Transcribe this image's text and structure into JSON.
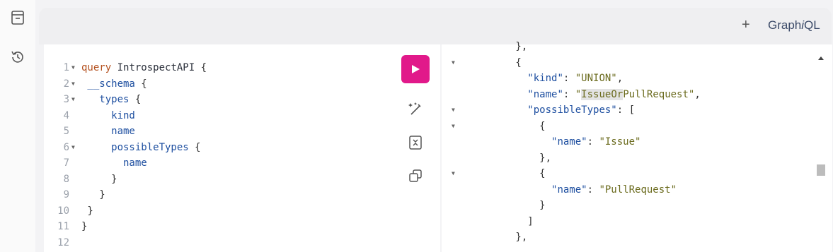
{
  "header": {
    "add_tab_label": "+",
    "brand_prefix": "Graph",
    "brand_italic": "i",
    "brand_suffix": "QL"
  },
  "sidebar": {
    "icons": [
      "docs-icon",
      "history-icon"
    ]
  },
  "editor": {
    "lines": [
      {
        "n": "1",
        "fold": true,
        "tokens": [
          {
            "t": "query",
            "c": "kw"
          },
          {
            "t": " IntrospectAPI ",
            "c": "def"
          },
          {
            "t": "{",
            "c": "punc"
          }
        ]
      },
      {
        "n": "2",
        "fold": true,
        "tokens": [
          {
            "t": " __schema ",
            "c": "fld"
          },
          {
            "t": "{",
            "c": "punc"
          }
        ]
      },
      {
        "n": "3",
        "fold": true,
        "tokens": [
          {
            "t": "   types ",
            "c": "fld"
          },
          {
            "t": "{",
            "c": "punc"
          }
        ]
      },
      {
        "n": "4",
        "fold": false,
        "tokens": [
          {
            "t": "     kind",
            "c": "fld"
          }
        ]
      },
      {
        "n": "5",
        "fold": false,
        "tokens": [
          {
            "t": "     name",
            "c": "fld"
          }
        ]
      },
      {
        "n": "6",
        "fold": true,
        "tokens": [
          {
            "t": "     possibleTypes ",
            "c": "fld"
          },
          {
            "t": "{",
            "c": "punc"
          }
        ]
      },
      {
        "n": "7",
        "fold": false,
        "tokens": [
          {
            "t": "       name",
            "c": "fld"
          }
        ]
      },
      {
        "n": "8",
        "fold": false,
        "tokens": [
          {
            "t": "     }",
            "c": "punc"
          }
        ]
      },
      {
        "n": "9",
        "fold": false,
        "tokens": [
          {
            "t": "   }",
            "c": "punc"
          }
        ]
      },
      {
        "n": "10",
        "fold": false,
        "tokens": [
          {
            "t": " }",
            "c": "punc"
          }
        ]
      },
      {
        "n": "11",
        "fold": false,
        "tokens": [
          {
            "t": "}",
            "c": "punc"
          }
        ]
      },
      {
        "n": "12",
        "fold": false,
        "tokens": []
      }
    ]
  },
  "toolbar": {
    "run": "play-icon",
    "prettify": "prettify-icon",
    "merge": "merge-fragments-icon",
    "copy": "copy-icon"
  },
  "results": {
    "lines": [
      {
        "fold": false,
        "tokens": [
          {
            "t": "        },",
            "c": "punc"
          }
        ]
      },
      {
        "fold": true,
        "tokens": [
          {
            "t": "        {",
            "c": "punc"
          }
        ]
      },
      {
        "fold": false,
        "tokens": [
          {
            "t": "          ",
            "c": "punc"
          },
          {
            "t": "\"kind\"",
            "c": "fld"
          },
          {
            "t": ": ",
            "c": "punc"
          },
          {
            "t": "\"UNION\"",
            "c": "str"
          },
          {
            "t": ",",
            "c": "punc"
          }
        ]
      },
      {
        "fold": false,
        "tokens": [
          {
            "t": "          ",
            "c": "punc"
          },
          {
            "t": "\"name\"",
            "c": "fld"
          },
          {
            "t": ": ",
            "c": "punc"
          },
          {
            "t": "\"",
            "c": "str"
          },
          {
            "t": "IssueOr",
            "c": "str hl"
          },
          {
            "t": "PullRequest\"",
            "c": "str"
          },
          {
            "t": ",",
            "c": "punc"
          }
        ]
      },
      {
        "fold": true,
        "tokens": [
          {
            "t": "          ",
            "c": "punc"
          },
          {
            "t": "\"possibleTypes\"",
            "c": "fld"
          },
          {
            "t": ": [",
            "c": "punc"
          }
        ]
      },
      {
        "fold": true,
        "tokens": [
          {
            "t": "            {",
            "c": "punc"
          }
        ]
      },
      {
        "fold": false,
        "tokens": [
          {
            "t": "              ",
            "c": "punc"
          },
          {
            "t": "\"name\"",
            "c": "fld"
          },
          {
            "t": ": ",
            "c": "punc"
          },
          {
            "t": "\"Issue\"",
            "c": "str"
          }
        ]
      },
      {
        "fold": false,
        "tokens": [
          {
            "t": "            },",
            "c": "punc"
          }
        ]
      },
      {
        "fold": true,
        "tokens": [
          {
            "t": "            {",
            "c": "punc"
          }
        ]
      },
      {
        "fold": false,
        "tokens": [
          {
            "t": "              ",
            "c": "punc"
          },
          {
            "t": "\"name\"",
            "c": "fld"
          },
          {
            "t": ": ",
            "c": "punc"
          },
          {
            "t": "\"PullRequest\"",
            "c": "str"
          }
        ]
      },
      {
        "fold": false,
        "tokens": [
          {
            "t": "            }",
            "c": "punc"
          }
        ]
      },
      {
        "fold": false,
        "tokens": [
          {
            "t": "          ]",
            "c": "punc"
          }
        ]
      },
      {
        "fold": false,
        "tokens": [
          {
            "t": "        },",
            "c": "punc"
          }
        ]
      }
    ]
  },
  "colors": {
    "run": "#e1198a",
    "brand": "#3b4a68"
  }
}
